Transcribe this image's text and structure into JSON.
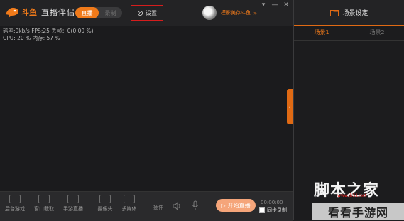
{
  "app": {
    "brand": "斗鱼",
    "name": "直播伴侣"
  },
  "mode": {
    "live_label": "直播",
    "record_label": "录制"
  },
  "settings": {
    "label": "设置"
  },
  "user": {
    "name": "模影美存斗鱼",
    "chevron": "»"
  },
  "window_controls": {
    "pin": "▾",
    "minimize": "—",
    "close": "✕"
  },
  "stats": {
    "line1": "码率:0kb/s   FPS:25   丢帧：0(0.00 %)",
    "line2": "CPU: 20 %     内存: 57 %"
  },
  "toolbar": {
    "items": [
      {
        "label": "后台游戏",
        "icon": "gamepad-icon"
      },
      {
        "label": "窗口截取",
        "icon": "monitor-icon"
      },
      {
        "label": "手游直播",
        "icon": "phone-play-icon"
      },
      {
        "label": "摄像头",
        "icon": "camera-icon"
      },
      {
        "label": "多媒体",
        "icon": "media-icon"
      }
    ],
    "plugin_label": "插件",
    "start_label": "开始直播",
    "timer": "00:00:00",
    "sync_record_label": "同步录制"
  },
  "right_panel": {
    "title": "场景设定",
    "tabs": [
      {
        "label": "场景1",
        "active": true
      },
      {
        "label": "场景2",
        "active": false
      }
    ]
  },
  "watermarks": {
    "text1": "脚本之家",
    "url": "www.jb51.net",
    "text2": "看看手游网"
  },
  "colors": {
    "accent": "#f07a1a",
    "settings_highlight": "#d61d1d",
    "background": "#1e1e20"
  }
}
